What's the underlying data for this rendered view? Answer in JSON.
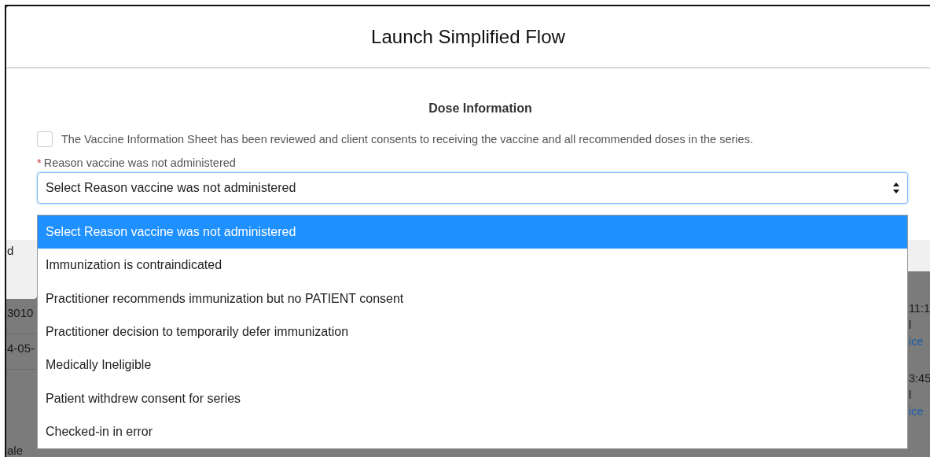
{
  "dialog": {
    "title": "Launch Simplified Flow",
    "section_title": "Dose Information",
    "consent": {
      "label": "The Vaccine Information Sheet has been reviewed and client consents to receiving the vaccine and all recommended doses in the series.",
      "checked": false
    },
    "reason_field": {
      "required_mark": "*",
      "label": "Reason vaccine was not administered",
      "value": "Select Reason vaccine was not administered",
      "expanded": true,
      "options": [
        {
          "label": "Select Reason vaccine was not administered",
          "selected": true
        },
        {
          "label": "Immunization is contraindicated",
          "selected": false
        },
        {
          "label": "Practitioner recommends immunization but no PATIENT consent",
          "selected": false
        },
        {
          "label": "Practitioner decision to temporarily defer immunization",
          "selected": false
        },
        {
          "label": "Medically Ineligible",
          "selected": false
        },
        {
          "label": "Patient withdrew consent for series",
          "selected": false
        },
        {
          "label": "Checked-in in error",
          "selected": false
        }
      ]
    }
  },
  "background": {
    "left_column": [
      {
        "text": "d",
        "kind": "footer"
      },
      {
        "text": "3010",
        "kind": "text"
      },
      {
        "text": "4-05-",
        "kind": "text"
      },
      {
        "text": "ale",
        "kind": "text"
      }
    ],
    "right_column": [
      {
        "text": "11:1",
        "kind": "text"
      },
      {
        "text": "l",
        "kind": "text"
      },
      {
        "text": "ice",
        "kind": "link"
      },
      {
        "text": "3:45",
        "kind": "text"
      },
      {
        "text": "l",
        "kind": "text"
      },
      {
        "text": "ice",
        "kind": "link"
      }
    ]
  }
}
